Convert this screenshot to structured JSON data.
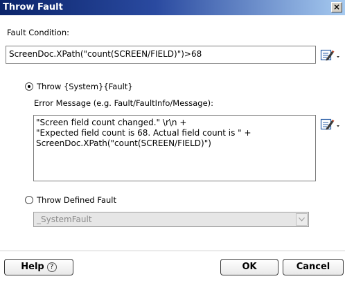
{
  "window": {
    "title": "Throw Fault",
    "close_glyph": "×"
  },
  "fault_condition": {
    "label": "Fault Condition:",
    "value": "ScreenDoc.XPath(\"count(SCREEN/FIELD)\")>68"
  },
  "throw_system": {
    "label": "Throw {System}{Fault}",
    "selected": true
  },
  "error_message": {
    "label": "Error Message (e.g. Fault/FaultInfo/Message):",
    "value": "\"Screen field count changed.\" \\r\\n +\n\"Expected field count is 68. Actual field count is \" +\nScreenDoc.XPath(\"count(SCREEN/FIELD)\")"
  },
  "throw_defined": {
    "label": "Throw Defined Fault",
    "selected": false,
    "select_value": "_SystemFault"
  },
  "buttons": {
    "help": "Help",
    "help_icon_glyph": "?",
    "ok": "OK",
    "cancel": "Cancel"
  },
  "icons": {
    "editor": "expression-editor-icon",
    "dropdown": "chevron-down-icon",
    "close": "close-icon"
  }
}
